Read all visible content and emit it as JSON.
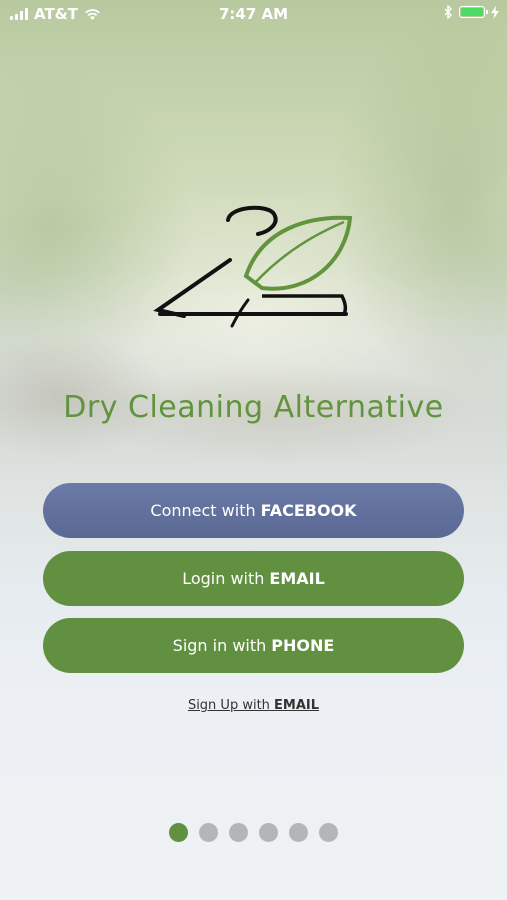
{
  "status_bar": {
    "carrier": "AT&T",
    "time": "7:47 AM",
    "battery_color": "#4cd964"
  },
  "brand": {
    "name": "Dry Cleaning Alternative",
    "color": "#62943e"
  },
  "buttons": {
    "facebook": {
      "prefix": "Connect with",
      "emphasis": "FACEBOOK",
      "color": "#5f6e9b"
    },
    "email": {
      "prefix": "Login with",
      "emphasis": "EMAIL",
      "color": "#609040"
    },
    "phone": {
      "prefix": "Sign in with",
      "emphasis": "PHONE",
      "color": "#609040"
    }
  },
  "signup": {
    "prefix": "Sign Up with",
    "emphasis": "EMAIL"
  },
  "pager": {
    "count": 6,
    "active_index": 0
  }
}
